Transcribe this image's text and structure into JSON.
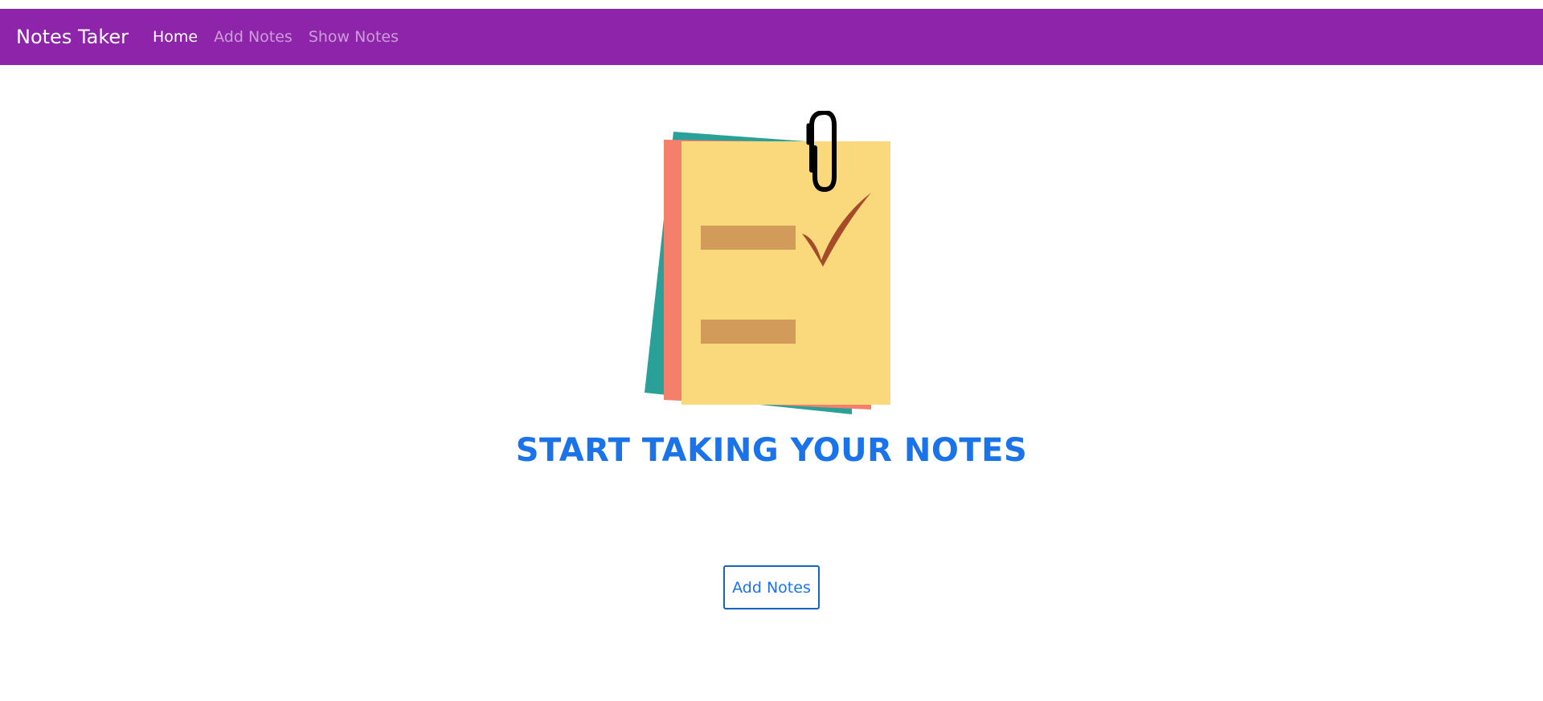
{
  "navbar": {
    "brand": "Notes Taker",
    "links": [
      {
        "label": "Home",
        "active": true
      },
      {
        "label": "Add Notes",
        "active": false
      },
      {
        "label": "Show Notes",
        "active": false
      }
    ],
    "background_color": "#8e24aa"
  },
  "hero": {
    "illustration": "sticky-notes-checklist-icon",
    "headline": "START TAKING YOUR NOTES",
    "headline_color": "#1a73e8"
  },
  "cta": {
    "label": "Add Notes",
    "border_color": "#1565c0"
  }
}
